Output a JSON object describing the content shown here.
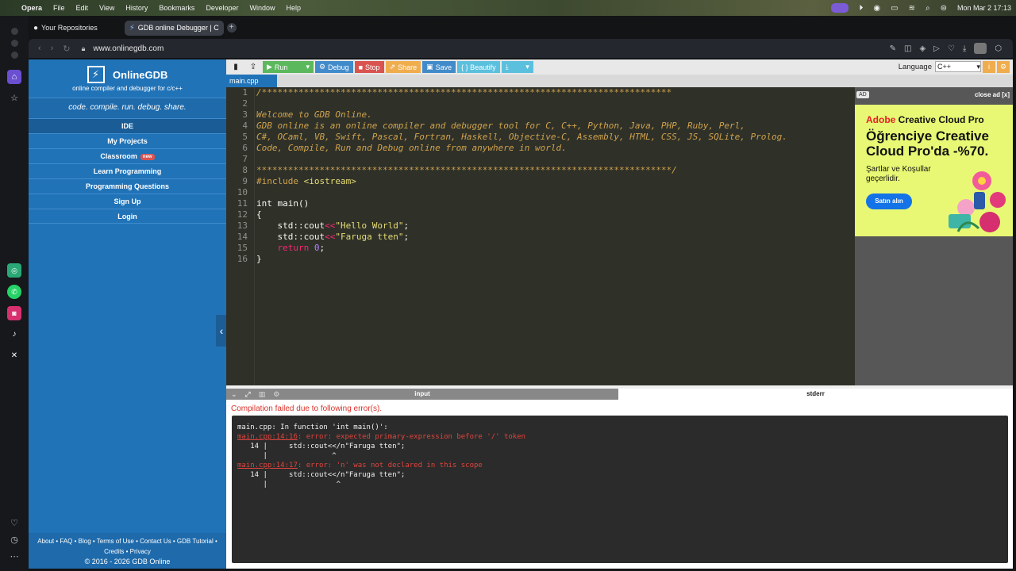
{
  "menubar": {
    "app": "Opera",
    "items": [
      "File",
      "Edit",
      "View",
      "History",
      "Bookmarks",
      "Developer",
      "Window",
      "Help"
    ],
    "datetime": "Mon Mar 2  17:13"
  },
  "tabs": [
    {
      "label": "Your Repositories",
      "icon": "github-icon"
    },
    {
      "label": "GDB online Debugger | C",
      "icon": "gdb-bolt-icon"
    }
  ],
  "address": {
    "url": "www.onlinegdb.com"
  },
  "left": {
    "logo_title": "OnlineGDB",
    "logo_glyph": "⚡",
    "logo_sub": "online compiler and debugger for c/c++",
    "tagline": "code. compile. run. debug. share.",
    "menu": [
      "IDE",
      "My Projects",
      "Classroom",
      "Learn Programming",
      "Programming Questions",
      "Sign Up",
      "Login"
    ],
    "new_badge": "new",
    "footer_line1": "About • FAQ • Blog • Terms of Use • Contact Us • GDB Tutorial •",
    "footer_line2": "Credits • Privacy",
    "copyright": "© 2016 - 2026 GDB Online"
  },
  "toolbar": {
    "run": "Run",
    "debug": "Debug",
    "stop": "Stop",
    "share": "Share",
    "save": "Save",
    "beautify": "{ } Beautify",
    "language_label": "Language",
    "language_value": "C++"
  },
  "file_tab": "main.cpp",
  "code": {
    "line_numbers": [
      "1",
      "2",
      "3",
      "4",
      "5",
      "6",
      "7",
      "8",
      "9",
      "10",
      "11",
      "12",
      "13",
      "14",
      "15",
      "16"
    ],
    "l1": "/******************************************************************************",
    "l3": "Welcome to GDB Online.",
    "l4": "GDB online is an online compiler and debugger tool for C, C++, Python, Java, PHP, Ruby, Perl,",
    "l5": "C#, OCaml, VB, Swift, Pascal, Fortran, Haskell, Objective-C, Assembly, HTML, CSS, JS, SQLite, Prolog.",
    "l6": "Code, Compile, Run and Debug online from anywhere in world.",
    "l8": "*******************************************************************************/",
    "l9_dir": "#include",
    "l9_hdr": " <iostream>",
    "l11": "int main()",
    "l12": "{",
    "l13_a": "    std::cout",
    "l13_op": "<<",
    "l13_str": "\"Hello World\"",
    "l13_end": ";",
    "l14_a": "    std::cout",
    "l14_op": "<<",
    "l14_str": "\"Faruga tten\"",
    "l14_end": ";",
    "l15_kw": "    return",
    "l15_num": " 0",
    "l15_end": ";",
    "l16": "}"
  },
  "ad": {
    "label": "AD",
    "close": "close ad [x]",
    "brand_adobe": "Adobe",
    "brand_rest": " Creative Cloud Pro",
    "headline": "Öğrenciye Creative Cloud Pro'da -%70.",
    "terms": "Şartlar ve Koşullar geçerlidir.",
    "cta": "Satın alın"
  },
  "output": {
    "input_tab": "input",
    "stderr_tab": "stderr",
    "error_title": "Compilation failed due to following error(s).",
    "c1": "main.cpp: In function 'int main()':",
    "c2_loc": "main.cpp:14:16",
    "c2_msg": ": error: expected primary-expression before '/' token",
    "c3": "   14 |     std::cout<</n\"Faruga tten\";",
    "c4": "      |               ^",
    "c5_loc": "main.cpp:14:17",
    "c5_msg": ": error: 'n' was not declared in this scope",
    "c6": "   14 |     std::cout<</n\"Faruga tten\";",
    "c7": "      |                ^"
  },
  "colors": {
    "brand_blue": "#2173b8",
    "run_green": "#5cb85c",
    "stop_red": "#d9534f",
    "share_orange": "#f0ad4e",
    "ad_bg": "#e8f874"
  }
}
